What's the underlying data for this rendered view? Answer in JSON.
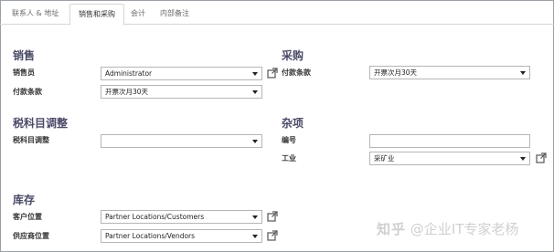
{
  "tabs": [
    {
      "label": "联系人 & 地址",
      "active": false
    },
    {
      "label": "销售和采购",
      "active": true
    },
    {
      "label": "会计",
      "active": false
    },
    {
      "label": "内部备注",
      "active": false
    }
  ],
  "sales": {
    "title": "销售",
    "salesperson_label": "销售员",
    "salesperson_value": "Administrator",
    "payment_terms_label": "付款条款",
    "payment_terms_value": "开票次月30天"
  },
  "purchase": {
    "title": "采购",
    "payment_terms_label": "付款条款",
    "payment_terms_value": "开票次月30天"
  },
  "fiscal": {
    "title": "税科目调整",
    "position_label": "税科目调整",
    "position_value": ""
  },
  "misc": {
    "title": "杂项",
    "reference_label": "编号",
    "reference_value": "",
    "industry_label": "工业",
    "industry_value": "采矿业"
  },
  "inventory": {
    "title": "库存",
    "customer_location_label": "客户位置",
    "customer_location_value": "Partner Locations/Customers",
    "vendor_location_label": "供应商位置",
    "vendor_location_value": "Partner Locations/Vendors"
  },
  "watermark": {
    "logo": "知乎",
    "text": "@企业IT专家老杨"
  },
  "colors": {
    "section_title": "#4a4a68",
    "border": "#b5b5b5"
  }
}
